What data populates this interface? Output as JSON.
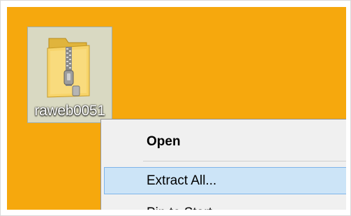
{
  "file": {
    "name": "raweb0051",
    "icon": "zip-folder-icon"
  },
  "context_menu": {
    "items": [
      {
        "label": "Open",
        "bold": true
      },
      {
        "label": "Extract All...",
        "hovered": true
      },
      {
        "label": "Pin to Start"
      }
    ]
  },
  "colors": {
    "desktop_background": "#f6a80d",
    "selection_highlight": "#cce4f7",
    "selection_border": "#7eb4ea",
    "menu_background": "#f0f0f0"
  }
}
